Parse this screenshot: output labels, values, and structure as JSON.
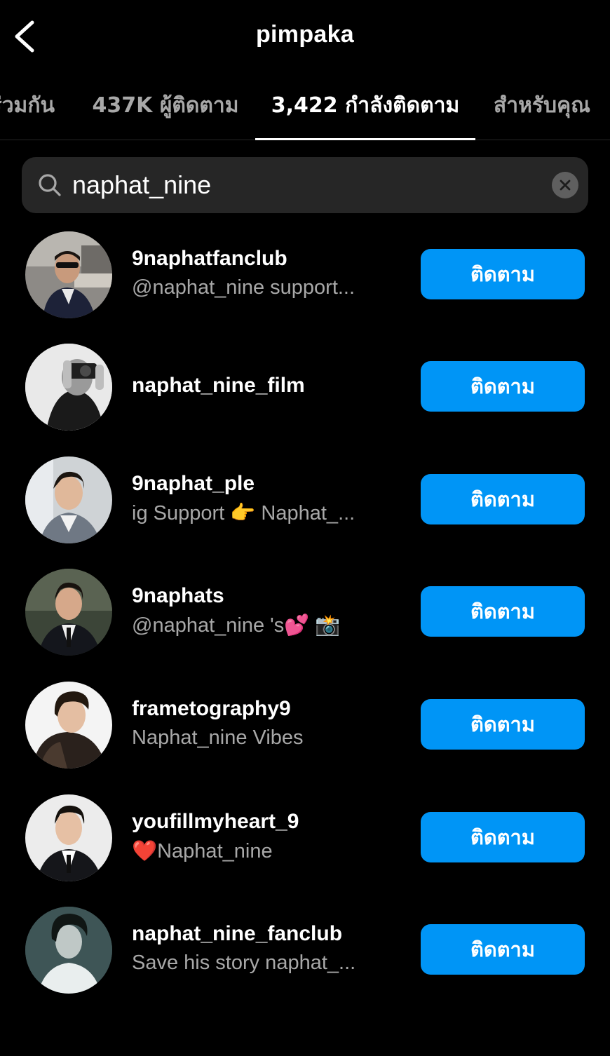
{
  "header": {
    "title": "pimpaka"
  },
  "tabs": [
    {
      "label": "ร่วมกัน",
      "active": false
    },
    {
      "label": "437K ผู้ติดตาม",
      "active": false
    },
    {
      "label": "3,422 กำลังติดตาม",
      "active": true
    },
    {
      "label": "สำหรับคุณ",
      "active": false
    }
  ],
  "search": {
    "value": "naphat_nine",
    "icon": "search-icon",
    "clear_icon": "close-icon"
  },
  "accounts": [
    {
      "username": "9naphatfanclub",
      "subtitle": "@naphat_nine support...",
      "button": "ติดตาม"
    },
    {
      "username": "naphat_nine_film",
      "subtitle": "",
      "button": "ติดตาม"
    },
    {
      "username": "9naphat_ple",
      "subtitle": "ig Support 👉  Naphat_...",
      "button": "ติดตาม"
    },
    {
      "username": "9naphats",
      "subtitle": "@naphat_nine 's💕 📸",
      "button": "ติดตาม"
    },
    {
      "username": "frametography9",
      "subtitle": "Naphat_nine Vibes",
      "button": "ติดตาม"
    },
    {
      "username": "youfillmyheart_9",
      "subtitle": "❤️Naphat_nine",
      "button": "ติดตาม"
    },
    {
      "username": "naphat_nine_fanclub",
      "subtitle": "Save his story naphat_...",
      "button": "ติดตาม"
    }
  ],
  "colors": {
    "background": "#000000",
    "follow_button": "#0095f6",
    "search_bg": "#262626",
    "secondary_text": "#a8a8a8"
  }
}
